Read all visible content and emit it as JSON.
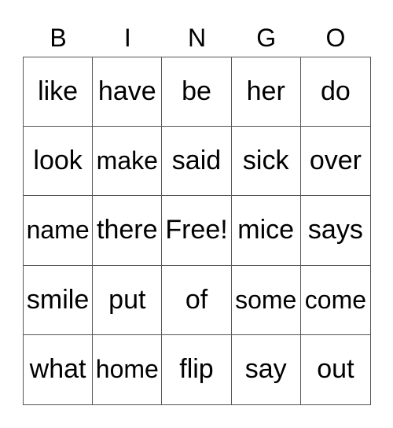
{
  "header": [
    "B",
    "I",
    "N",
    "G",
    "O"
  ],
  "cells": [
    "like",
    "have",
    "be",
    "her",
    "do",
    "look",
    "make",
    "said",
    "sick",
    "over",
    "name",
    "there",
    "Free!",
    "mice",
    "says",
    "smile",
    "put",
    "of",
    "some",
    "come",
    "what",
    "home",
    "flip",
    "say",
    "out"
  ]
}
